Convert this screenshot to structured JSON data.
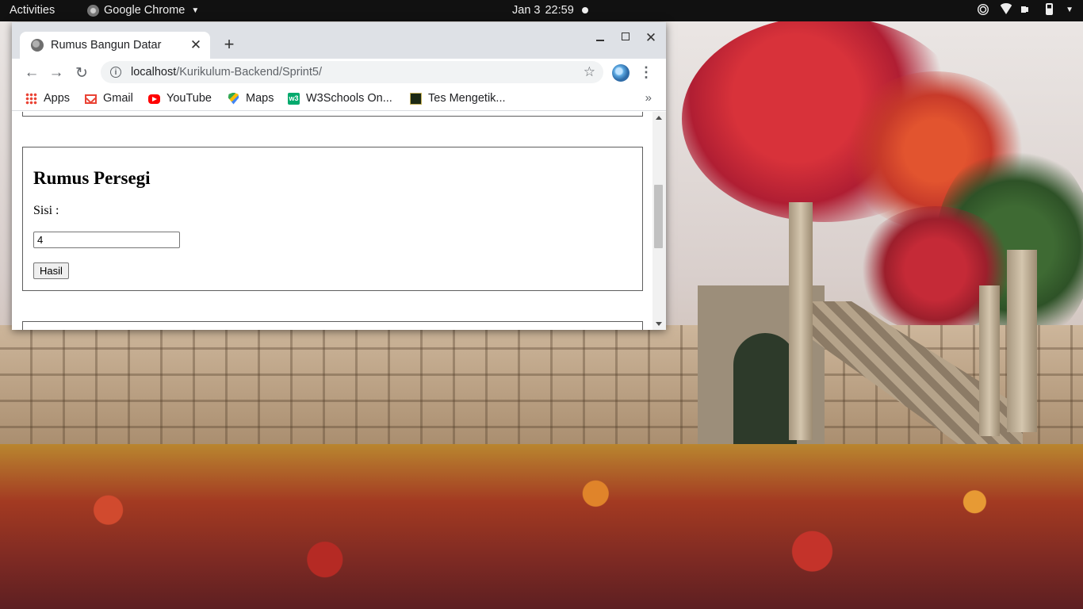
{
  "topbar": {
    "activities": "Activities",
    "app_name": "Google Chrome",
    "date": "Jan 3",
    "time": "22:59"
  },
  "browser": {
    "tab": {
      "title": "Rumus Bangun Datar",
      "favicon": "globe-icon"
    },
    "url": {
      "host": "localhost",
      "path": "/Kurikulum-Backend/Sprint5/"
    },
    "bookmarks": [
      {
        "label": "Apps",
        "icon": "apps-grid-icon"
      },
      {
        "label": "Gmail",
        "icon": "gmail-icon"
      },
      {
        "label": "YouTube",
        "icon": "youtube-icon"
      },
      {
        "label": "Maps",
        "icon": "maps-icon"
      },
      {
        "label": "W3Schools On...",
        "icon": "w3schools-icon"
      },
      {
        "label": "Tes Mengetik...",
        "icon": "tes-mengetik-icon"
      }
    ],
    "bookmarks_overflow": "»"
  },
  "page": {
    "section": {
      "heading": "Rumus Persegi",
      "label": "Sisi :",
      "input_value": "4",
      "button_label": "Hasil"
    },
    "scroll_position": 0.35
  },
  "colors": {
    "topbar_bg": "#111111",
    "tabstrip_bg": "#dee1e6",
    "omnibox_bg": "#f1f3f4"
  }
}
